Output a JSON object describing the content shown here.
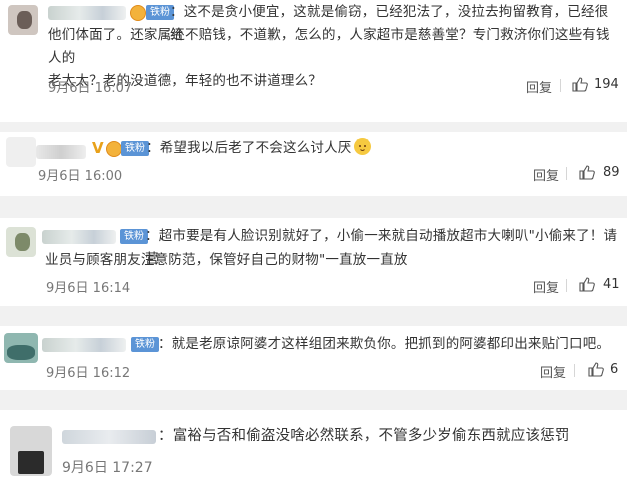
{
  "comments": [
    {
      "badge": "铁粉",
      "text_line1": "：这不是贪小便宜，这就是偷窃，已经犯法了，没拉去拘留教育，已经很给",
      "text_line2": "他们体面了。还家属还不赔钱，不道歉，怎么的，人家超市是慈善堂？专门救济你们这些有钱人的",
      "text_line3": "老太太？老的没道德，年轻的也不讲道理么？",
      "date": "9月6日 16:07",
      "reply": "回复",
      "likes": "194"
    },
    {
      "badge": "铁粉",
      "v_mark": "V",
      "text_line1": "：希望我以后老了不会这么讨人厌",
      "emoji": "cat-face-emoji",
      "date": "9月6日 16:00",
      "reply": "回复",
      "likes": "89"
    },
    {
      "badge": "铁粉",
      "text_line1": "：超市要是有人脸识别就好了，小偷一来就自动播放超市大喇叭\"小偷来了！请营",
      "text_line2": "业员与顾客朋友注意防范，保管好自己的财物\"一直放一直放",
      "date": "9月6日 16:14",
      "reply": "回复",
      "likes": "41"
    },
    {
      "badge": "铁粉",
      "text_line1": "：就是老原谅阿婆才这样组团来欺负你。把抓到的阿婆都印出来贴门口吧。",
      "date": "9月6日 16:12",
      "reply": "回复",
      "likes": "6"
    },
    {
      "text_line1": "：富裕与否和偷盗没啥必然联系，不管多少岁偷东西就应该惩罚",
      "date": "9月6日 17:27"
    }
  ]
}
